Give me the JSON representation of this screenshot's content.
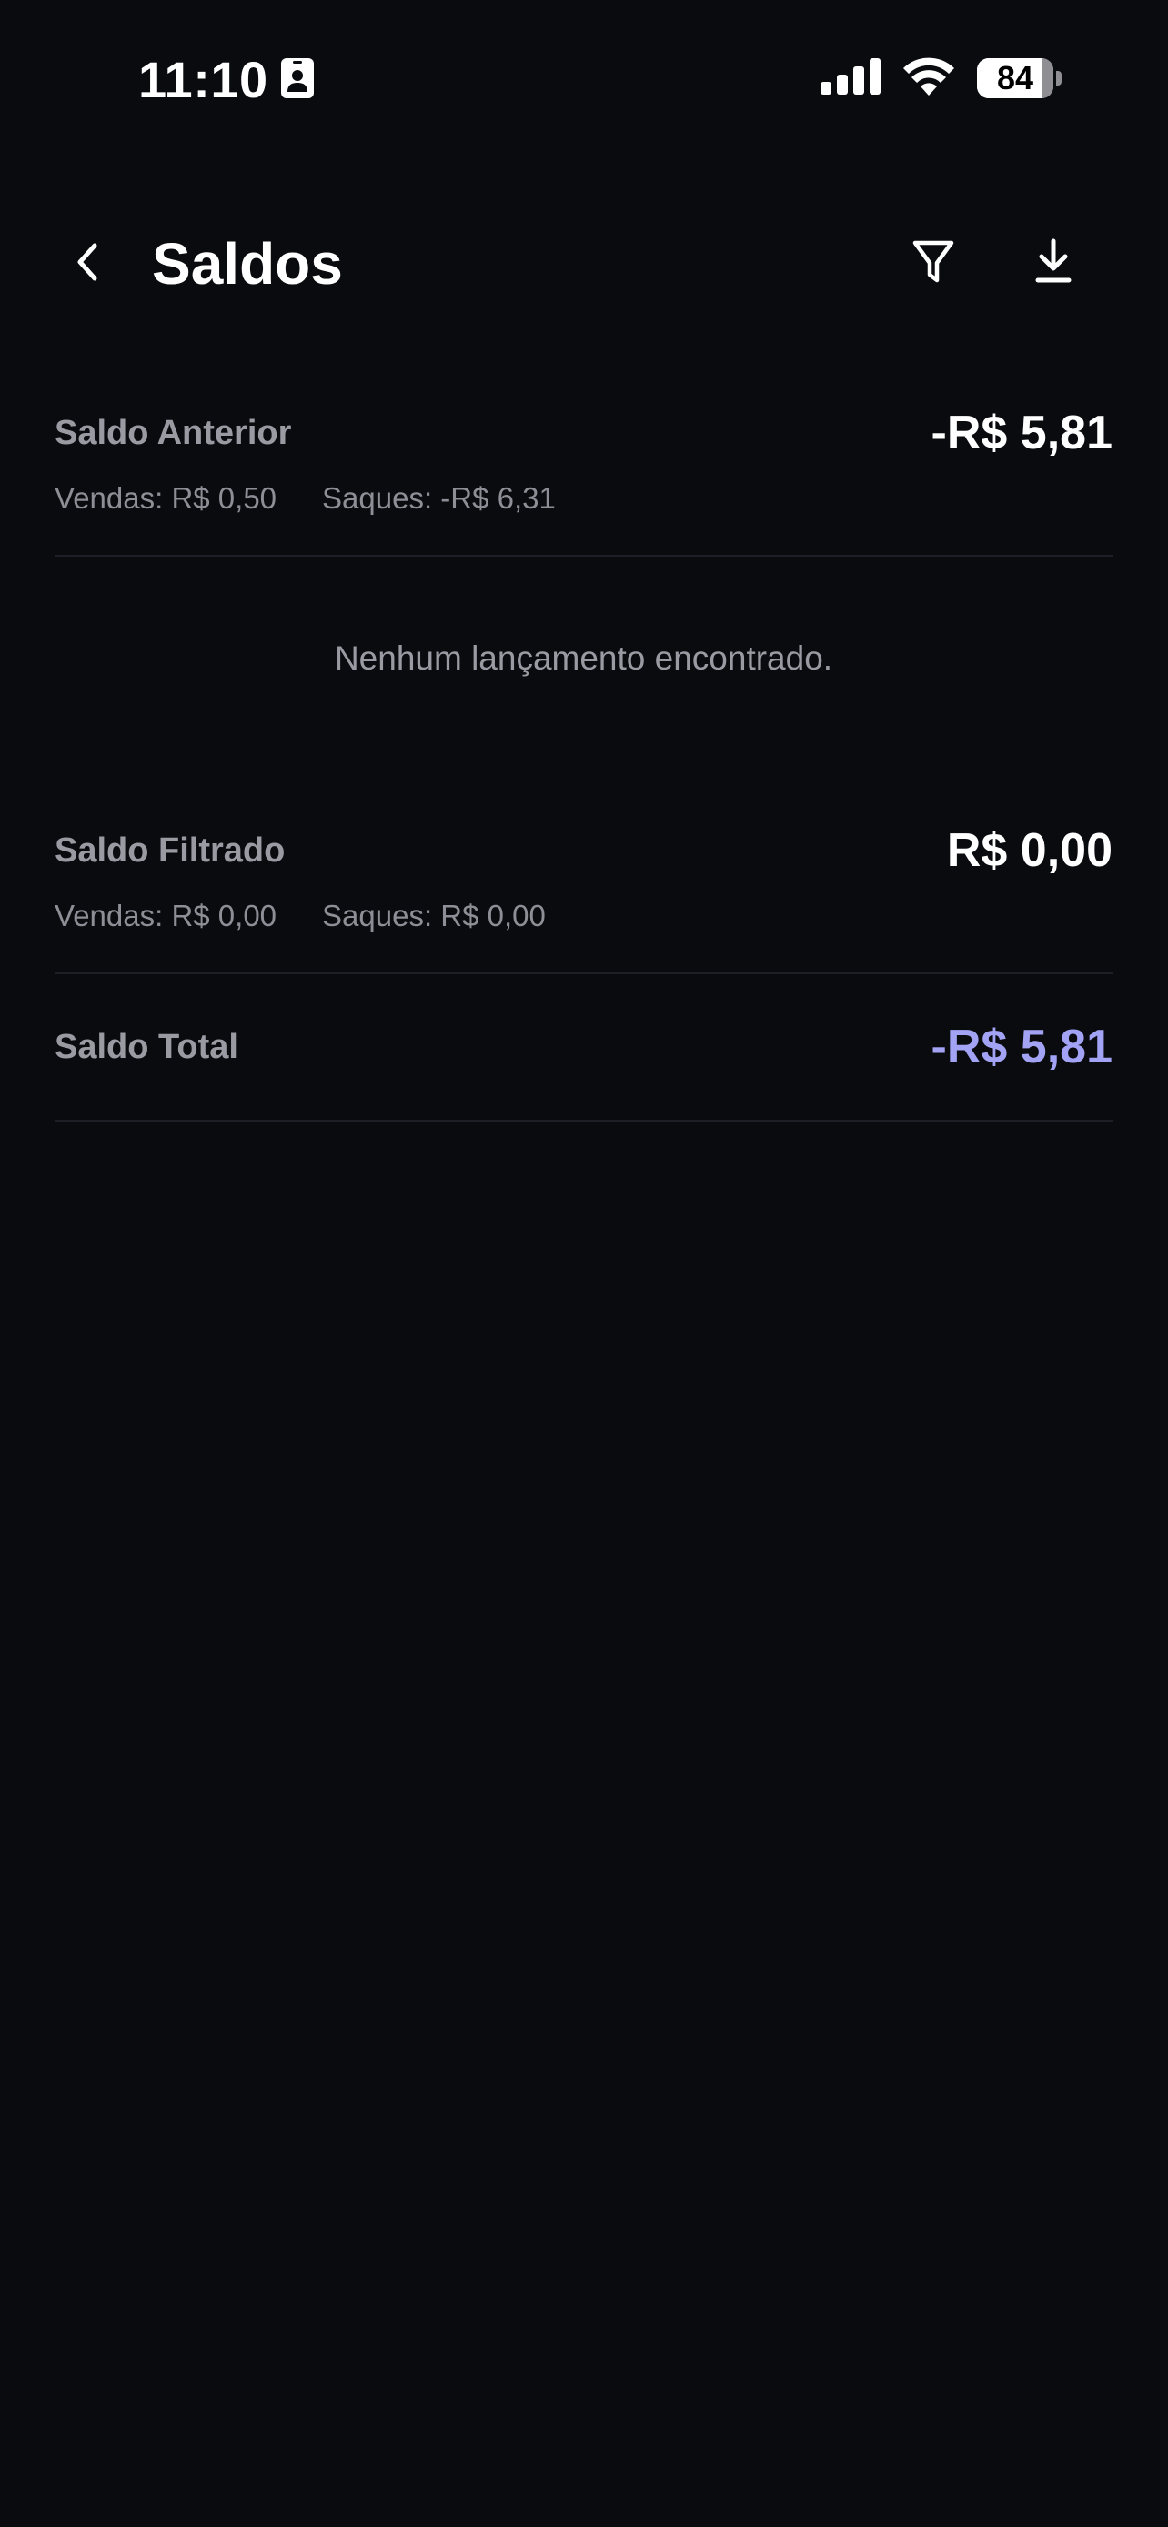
{
  "status_bar": {
    "time": "11:10",
    "battery_percent": "84",
    "battery_level": 0.84,
    "icons": [
      "contact-card-icon",
      "signal-icon",
      "wifi-icon",
      "battery-icon"
    ]
  },
  "header": {
    "title": "Saldos",
    "icons": [
      "chevron-left-icon",
      "filter-icon",
      "download-icon"
    ]
  },
  "saldo_anterior": {
    "label": "Saldo Anterior",
    "value": "-R$ 5,81",
    "vendas": "Vendas: R$ 0,50",
    "saques": "Saques: -R$ 6,31"
  },
  "empty_state": {
    "message": "Nenhum lançamento encontrado."
  },
  "saldo_filtrado": {
    "label": "Saldo Filtrado",
    "value": "R$ 0,00",
    "vendas": "Vendas: R$ 0,00",
    "saques": "Saques: R$ 0,00"
  },
  "saldo_total": {
    "label": "Saldo Total",
    "value": "-R$ 5,81"
  },
  "colors": {
    "background": "#0a0b0f",
    "accent": "#a3a3f5",
    "label": "#9a9aa3",
    "divider": "#1e1f26"
  }
}
